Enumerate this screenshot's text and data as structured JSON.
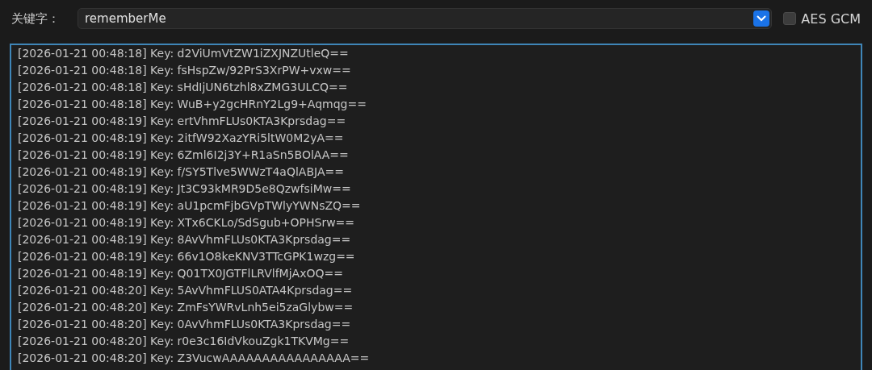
{
  "keyword": {
    "label": "关键字：",
    "value": "rememberMe"
  },
  "aes_gcm": {
    "label": "AES GCM",
    "checked": false
  },
  "log_lines": [
    "[2026-01-21 00:48:18] Key: d2ViUmVtZW1iZXJNZUtleQ==",
    "[2026-01-21 00:48:18] Key: fsHspZw/92PrS3XrPW+vxw==",
    "[2026-01-21 00:48:18] Key: sHdIjUN6tzhl8xZMG3ULCQ==",
    "[2026-01-21 00:48:18] Key: WuB+y2gcHRnY2Lg9+Aqmqg==",
    "[2026-01-21 00:48:19] Key: ertVhmFLUs0KTA3Kprsdag==",
    "[2026-01-21 00:48:19] Key: 2itfW92XazYRi5ltW0M2yA==",
    "[2026-01-21 00:48:19] Key: 6Zml6I2j3Y+R1aSn5BOlAA==",
    "[2026-01-21 00:48:19] Key: f/SY5Tlve5WWzT4aQlABJA==",
    "[2026-01-21 00:48:19] Key: Jt3C93kMR9D5e8QzwfsiMw==",
    "[2026-01-21 00:48:19] Key: aU1pcmFjbGVpTWlyYWNsZQ==",
    "[2026-01-21 00:48:19] Key: XTx6CKLo/SdSgub+OPHSrw==",
    "[2026-01-21 00:48:19] Key: 8AvVhmFLUs0KTA3Kprsdag==",
    "[2026-01-21 00:48:19] Key: 66v1O8keKNV3TTcGPK1wzg==",
    "[2026-01-21 00:48:19] Key: Q01TX0JGTFlLRVlfMjAxOQ==",
    "[2026-01-21 00:48:20] Key: 5AvVhmFLUS0ATA4Kprsdag==",
    "[2026-01-21 00:48:20] Key: ZmFsYWRvLnh5ei5zaGlybw==",
    "[2026-01-21 00:48:20] Key: 0AvVhmFLUs0KTA3Kprsdag==",
    "[2026-01-21 00:48:20] Key: r0e3c16IdVkouZgk1TKVMg==",
    "[2026-01-21 00:48:20] Key: Z3VucwAAAAAAAAAAAAAAAA=="
  ]
}
